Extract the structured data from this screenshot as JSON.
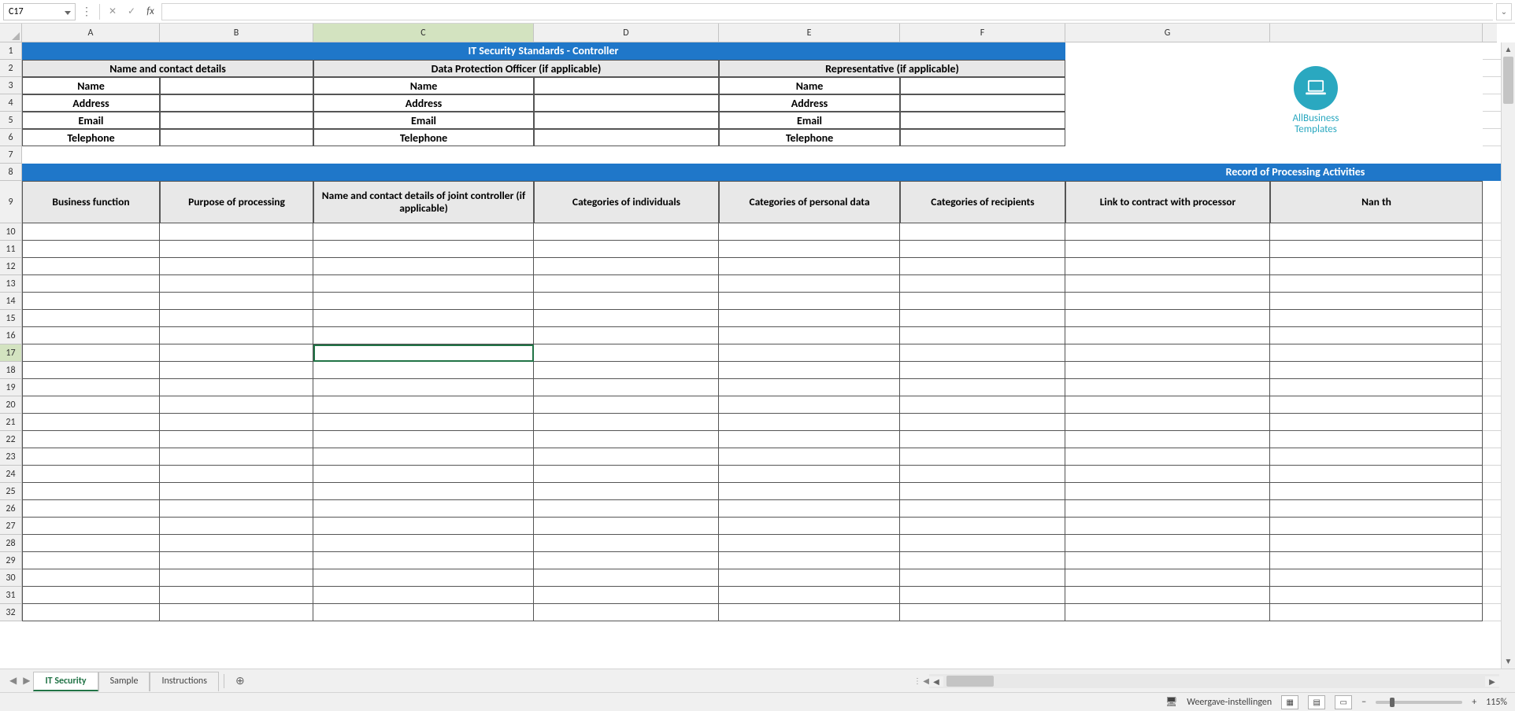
{
  "namebox": "C17",
  "fx_label": "fx",
  "title_row": "IT Security Standards - Controller",
  "header_blocks": [
    "Name and contact details",
    "Data Protection Officer (if applicable)",
    "Representative (if applicable)"
  ],
  "contact_fields": [
    "Name",
    "Address",
    "Email",
    "Telephone"
  ],
  "record_title": "Record of Processing Activities",
  "columns": [
    "A",
    "B",
    "C",
    "D",
    "E",
    "F",
    "G"
  ],
  "active_col": "C",
  "active_row": 17,
  "row_count": 32,
  "table_headers": [
    "Business function",
    "Purpose of processing",
    "Name and contact details of joint controller (if applicable)",
    "Categories of individuals",
    "Categories of personal data",
    "Categories of recipients",
    "Link to contract with processor",
    "Nan th"
  ],
  "logo": {
    "line1": "AllBusiness",
    "line2": "Templates"
  },
  "tabs": [
    "IT Security",
    "Sample",
    "Instructions"
  ],
  "active_tab": 0,
  "status": {
    "display_settings": "Weergave-instellingen",
    "zoom": "115%"
  }
}
